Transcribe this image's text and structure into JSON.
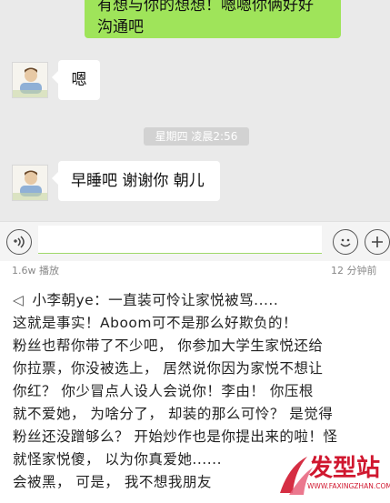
{
  "chat": {
    "outgoing_text_line1": "有想与你的想想！嗯嗯你俩好好",
    "outgoing_text_line2": "沟通吧",
    "message_1": "嗯",
    "timestamp": "星期四 凌晨2:56",
    "message_2": "早睡吧 谢谢你 朝儿"
  },
  "stats": {
    "plays": "1.6w 播放",
    "duration": "12 分钟前"
  },
  "note_lines": [
    "小李朝ye：一直装可怜让家悦被骂.....",
    "这就是事实！Aboom可不是那么好欺负的！",
    "粉丝也帮你带了不少吧， 你参加大学生家悦还给",
    "你拉票，你没被选上， 居然说你因为家悦不想让",
    "你红？ 你少冒点人设人会说你！李由！ 你压根",
    "就不爱她， 为啥分了， 却装的那么可怜？ 是觉得",
    "粉丝还没蹭够么？ 开始炒作也是你提出来的啦！怪",
    "就怪家悦傻， 以为你真爱她......",
    "会被黑， 可是， 我不想我朋友"
  ],
  "watermark": {
    "brand": "发型站",
    "url": "WWW.FAXINGZHAN.COM",
    "color": "#d0172f"
  },
  "icons": [
    "voice-icon",
    "emoji-icon",
    "plus-icon",
    "speaker-icon",
    "avatar"
  ]
}
